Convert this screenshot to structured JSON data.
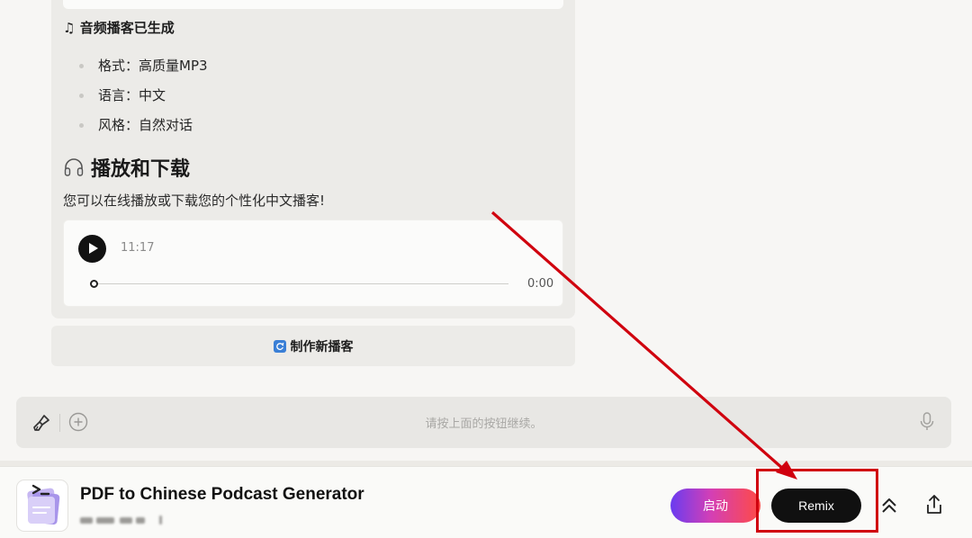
{
  "chat": {
    "audio_heading": "音频播客已生成",
    "details": [
      {
        "label": "格式：",
        "value": "高质量MP3"
      },
      {
        "label": "语言：",
        "value": "中文"
      },
      {
        "label": "风格：",
        "value": "自然对话"
      }
    ],
    "play_download_heading": "播放和下载",
    "play_download_desc": "您可以在线播放或下载您的个性化中文播客!",
    "player": {
      "duration": "11:17",
      "current_time": "0:00",
      "progress": 0
    },
    "new_podcast_button": "制作新播客"
  },
  "input_bar": {
    "placeholder": "请按上面的按钮继续。"
  },
  "footer": {
    "app_title": "PDF to Chinese Podcast Generator",
    "launch_button": "启动",
    "remix_button": "Remix"
  },
  "annotation": {
    "color": "#d0000e"
  },
  "icons": {
    "music": "music-note-icon",
    "headphones": "headphones-icon",
    "refresh": "refresh-icon",
    "brush": "brush-icon",
    "plus": "plus-circle-icon",
    "mic": "microphone-icon",
    "collapse": "double-chevron-up-icon",
    "share": "share-icon"
  }
}
